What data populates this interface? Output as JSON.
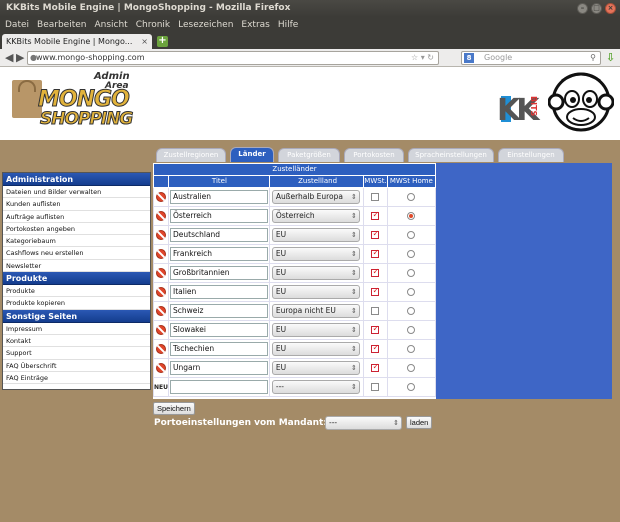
{
  "window": {
    "title": "KKBits Mobile Engine | MongoShopping - Mozilla Firefox"
  },
  "menu": [
    "Datei",
    "Bearbeiten",
    "Ansicht",
    "Chronik",
    "Lesezeichen",
    "Extras",
    "Hilfe"
  ],
  "browser_tab": {
    "title": "KKBits Mobile Engine | Mongo...",
    "new_tab_label": "+"
  },
  "address_bar": {
    "url": "www.mongo-shopping.com"
  },
  "search_bar": {
    "placeholder": "Google",
    "engine": "8"
  },
  "logo": {
    "line1": "Admin",
    "line2": "Area",
    "brand1": "MONGO",
    "brand2": "SHOPPING"
  },
  "kk_logo": {
    "letters": "KK",
    "bits": "BITS"
  },
  "admin_tabs": [
    {
      "label": "Zustellregionen",
      "active": false
    },
    {
      "label": "Länder",
      "active": true
    },
    {
      "label": "Paketgrößen",
      "active": false
    },
    {
      "label": "Portokosten",
      "active": false
    },
    {
      "label": "Spracheinstellungen",
      "active": false
    },
    {
      "label": "Einstellungen",
      "active": false
    }
  ],
  "sidebar": {
    "sections": [
      {
        "title": "Administration",
        "items": [
          "Dateien und Bilder verwalten",
          "Kunden auflisten",
          "Aufträge auflisten",
          "Portokosten angeben",
          "Kategoriebaum",
          "Cashflows neu erstellen",
          "Newsletter"
        ]
      },
      {
        "title": "Produkte",
        "items": [
          "Produkte",
          "Produkte kopieren"
        ]
      },
      {
        "title": "Sonstige Seiten",
        "items": [
          "Impressum",
          "Kontakt",
          "Support",
          "FAQ Überschrift",
          "FAQ Einträge"
        ]
      }
    ]
  },
  "table": {
    "caption": "Zustelländer",
    "headers": [
      "Titel",
      "Zustellland",
      "MWSt.",
      "MWSt Home"
    ],
    "rows": [
      {
        "title": "Australien",
        "land": "Außerhalb Europa",
        "mwst": false,
        "home": false
      },
      {
        "title": "Österreich",
        "land": "Österreich",
        "mwst": true,
        "home": true
      },
      {
        "title": "Deutschland",
        "land": "EU",
        "mwst": true,
        "home": false
      },
      {
        "title": "Frankreich",
        "land": "EU",
        "mwst": true,
        "home": false
      },
      {
        "title": "Großbritannien",
        "land": "EU",
        "mwst": true,
        "home": false
      },
      {
        "title": "Italien",
        "land": "EU",
        "mwst": true,
        "home": false
      },
      {
        "title": "Schweiz",
        "land": "Europa nicht EU",
        "mwst": false,
        "home": false
      },
      {
        "title": "Slowakei",
        "land": "EU",
        "mwst": true,
        "home": false
      },
      {
        "title": "Tschechien",
        "land": "EU",
        "mwst": true,
        "home": false
      },
      {
        "title": "Ungarn",
        "land": "EU",
        "mwst": true,
        "home": false
      }
    ],
    "new_row": {
      "label": "NEU",
      "title": "",
      "land": "---",
      "mwst": false,
      "home": false
    }
  },
  "save_label": "Speichern",
  "porto": {
    "label": "Portoeinstellungen vom Mandant:",
    "selected": "---",
    "button": "laden"
  },
  "colors": {
    "accent": "#2d5fbf",
    "page_bg": "#a48b67",
    "panel": "#3e66c6",
    "delete": "#e0452b"
  }
}
